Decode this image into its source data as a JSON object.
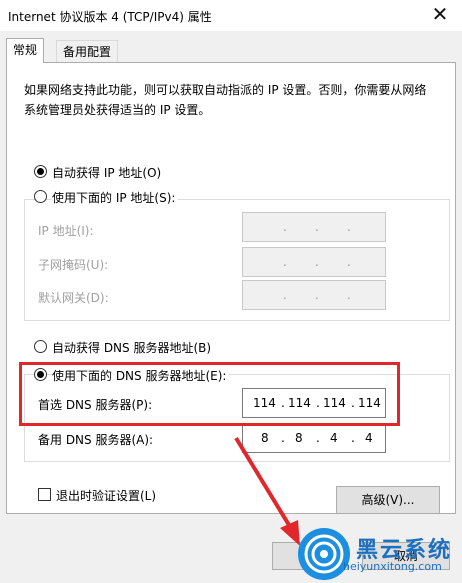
{
  "window": {
    "title": "Internet 协议版本 4 (TCP/IPv4) 属性",
    "close_glyph": "✕"
  },
  "tabs": [
    {
      "label": "常规",
      "active": true
    },
    {
      "label": "备用配置",
      "active": false
    }
  ],
  "description": "如果网络支持此功能，则可以获取自动指派的 IP 设置。否则，你需要从网络系统管理员处获得适当的 IP 设置。",
  "ip_section": {
    "auto_label": "自动获得 IP 地址(O)",
    "auto_checked": true,
    "manual_label": "使用下面的 IP 地址(S):",
    "fields": [
      {
        "label": "IP 地址(I):"
      },
      {
        "label": "子网掩码(U):"
      },
      {
        "label": "默认网关(D):"
      }
    ]
  },
  "dns_section": {
    "auto_label": "自动获得 DNS 服务器地址(B)",
    "manual_label": "使用下面的 DNS 服务器地址(E):",
    "manual_checked": true,
    "preferred": {
      "label": "首选 DNS 服务器(P):",
      "octets": [
        "114",
        "114",
        "114",
        "114"
      ]
    },
    "alternate": {
      "label": "备用 DNS 服务器(A):",
      "octets": [
        "8",
        "8",
        "4",
        "4"
      ]
    }
  },
  "validate_label": "退出时验证设置(L)",
  "advanced_button": "高级(V)...",
  "cancel_button": "取消",
  "watermark": {
    "brand": "黑云系统",
    "url": "heiyunxitong.com"
  },
  "colors": {
    "highlight": "#e1262c",
    "watermark": "#1d8fe0"
  }
}
